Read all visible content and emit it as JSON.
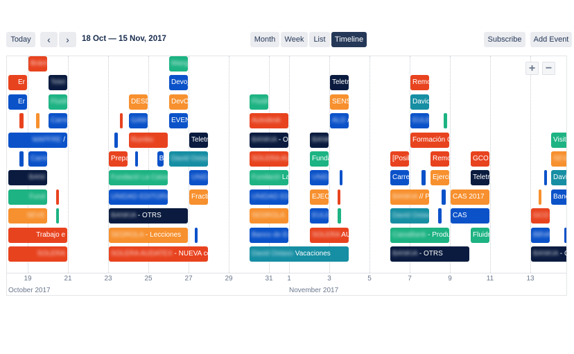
{
  "toolbar": {
    "today_label": "Today",
    "prev_icon": "chevron-left",
    "next_icon": "chevron-right",
    "prev_glyph": "‹",
    "next_glyph": "›",
    "date_range": "18 Oct — 15 Nov, 2017",
    "views": [
      {
        "label": "Month",
        "active": false
      },
      {
        "label": "Week",
        "active": false
      },
      {
        "label": "List",
        "active": false
      },
      {
        "label": "Timeline",
        "active": true
      }
    ],
    "subscribe_label": "Subscribe",
    "add_event_label": "Add Event"
  },
  "zoom_controls": {
    "zoom_in_glyph": "+",
    "zoom_out_glyph": "−"
  },
  "colors": {
    "red": "#e8431f",
    "blue": "#0b52c9",
    "green": "#1db382",
    "orange": "#f7902e",
    "navy": "#0a1b3f",
    "teal": "#168ea3",
    "active_view": "#253858"
  },
  "axis": {
    "start_date": "2017-10-18",
    "ticks": [
      {
        "label": "19",
        "day": 1
      },
      {
        "label": "21",
        "day": 3
      },
      {
        "label": "23",
        "day": 5
      },
      {
        "label": "25",
        "day": 7
      },
      {
        "label": "27",
        "day": 9
      },
      {
        "label": "29",
        "day": 11
      },
      {
        "label": "31",
        "day": 13
      },
      {
        "label": "1",
        "day": 14
      },
      {
        "label": "3",
        "day": 16
      },
      {
        "label": "5",
        "day": 18
      },
      {
        "label": "7",
        "day": 20
      },
      {
        "label": "9",
        "day": 22
      },
      {
        "label": "11",
        "day": 24
      },
      {
        "label": "13",
        "day": 26
      },
      {
        "label": "15",
        "day": 28
      }
    ],
    "months": [
      {
        "label": "October 2017",
        "day": 0
      },
      {
        "label": "November 2017",
        "day": 14
      }
    ]
  },
  "events": [
    {
      "row": 0,
      "start": 1.0,
      "end": 2.0,
      "color": "red",
      "hidden": "Bránt",
      "text": ""
    },
    {
      "row": 0,
      "start": 8.0,
      "end": 9.0,
      "color": "green",
      "hidden": "Mang",
      "text": ""
    },
    {
      "row": 1,
      "start": 0.0,
      "end": 1.0,
      "color": "red",
      "hidden": "",
      "text": "Er",
      "align": "r"
    },
    {
      "row": 1,
      "start": 2.0,
      "end": 3.0,
      "color": "navy",
      "hidden": "Telet",
      "text": ""
    },
    {
      "row": 1,
      "start": 8.0,
      "end": 9.0,
      "color": "blue",
      "hidden": "",
      "text": "Devoj"
    },
    {
      "row": 1,
      "start": 16.0,
      "end": 17.0,
      "color": "navy",
      "hidden": "",
      "text": "Teletr"
    },
    {
      "row": 1,
      "start": 20.0,
      "end": 21.0,
      "color": "red",
      "hidden": "",
      "text": "Remo"
    },
    {
      "row": 2,
      "start": 0.0,
      "end": 1.0,
      "color": "blue",
      "hidden": "",
      "text": "Er",
      "align": "r"
    },
    {
      "row": 2,
      "start": 2.0,
      "end": 3.0,
      "color": "green",
      "hidden": "Fluidi",
      "text": ""
    },
    {
      "row": 2,
      "start": 6.0,
      "end": 7.0,
      "color": "orange",
      "hidden": "",
      "text": "DESD"
    },
    {
      "row": 2,
      "start": 8.0,
      "end": 9.0,
      "color": "orange",
      "hidden": "",
      "text": "DevO"
    },
    {
      "row": 2,
      "start": 12.0,
      "end": 13.0,
      "color": "green",
      "hidden": "Fluidi",
      "text": ""
    },
    {
      "row": 2,
      "start": 16.0,
      "end": 17.0,
      "color": "orange",
      "hidden": "",
      "text": "SENS"
    },
    {
      "row": 2,
      "start": 20.0,
      "end": 21.0,
      "color": "teal",
      "hidden": "",
      "text": "David"
    },
    {
      "row": 3,
      "start": 0.6,
      "end": 0.8,
      "color": "red",
      "hidden": "",
      "text": "",
      "thin": true
    },
    {
      "row": 3,
      "start": 1.4,
      "end": 1.6,
      "color": "orange",
      "hidden": "",
      "text": "",
      "thin": true
    },
    {
      "row": 3,
      "start": 2.0,
      "end": 3.0,
      "color": "blue",
      "hidden": "Carre",
      "text": ""
    },
    {
      "row": 3,
      "start": 5.6,
      "end": 5.72,
      "color": "red",
      "hidden": "",
      "text": "",
      "thin": true
    },
    {
      "row": 3,
      "start": 6.0,
      "end": 7.0,
      "color": "blue",
      "hidden": "GAM",
      "text": ""
    },
    {
      "row": 3,
      "start": 8.0,
      "end": 9.0,
      "color": "blue",
      "hidden": "",
      "text": "EVEN"
    },
    {
      "row": 3,
      "start": 12.0,
      "end": 14.0,
      "color": "red",
      "hidden": "Autodesk",
      "text": ""
    },
    {
      "row": 3,
      "start": 16.0,
      "end": 17.0,
      "color": "blue",
      "hidden": "ALD",
      "text": " /"
    },
    {
      "row": 3,
      "start": 20.0,
      "end": 21.0,
      "color": "blue",
      "hidden": "EULE",
      "text": ""
    },
    {
      "row": 3,
      "start": 21.7,
      "end": 21.85,
      "color": "green",
      "hidden": "",
      "text": "",
      "thin": true
    },
    {
      "row": 4,
      "start": 0.0,
      "end": 3.0,
      "color": "blue",
      "hidden": "MAPFRE",
      "text": " /",
      "align": "r"
    },
    {
      "row": 4,
      "start": 5.3,
      "end": 5.5,
      "color": "blue",
      "hidden": "",
      "text": "",
      "thin": true
    },
    {
      "row": 4,
      "start": 6.0,
      "end": 8.0,
      "color": "red",
      "hidden": "Rumbo",
      "text": ""
    },
    {
      "row": 4,
      "start": 9.0,
      "end": 10.0,
      "color": "navy",
      "hidden": "",
      "text": "Teletr"
    },
    {
      "row": 4,
      "start": 12.0,
      "end": 14.0,
      "color": "navy",
      "hidden": "BANKIA",
      "text": " - O'"
    },
    {
      "row": 4,
      "start": 15.0,
      "end": 16.0,
      "color": "navy",
      "hidden": "BANK",
      "text": ""
    },
    {
      "row": 4,
      "start": 20.0,
      "end": 22.0,
      "color": "red",
      "hidden": "",
      "text": "Formación C"
    },
    {
      "row": 4,
      "start": 27.0,
      "end": 28.0,
      "color": "green",
      "hidden": "",
      "text": "Visita"
    },
    {
      "row": 5,
      "start": 0.6,
      "end": 0.8,
      "color": "blue",
      "hidden": "",
      "text": "",
      "thin": true
    },
    {
      "row": 5,
      "start": 1.0,
      "end": 2.0,
      "color": "blue",
      "hidden": "Carre",
      "text": ""
    },
    {
      "row": 5,
      "start": 5.0,
      "end": 6.0,
      "color": "red",
      "hidden": "",
      "text": "Prepa"
    },
    {
      "row": 5,
      "start": 6.35,
      "end": 6.45,
      "color": "blue",
      "hidden": "",
      "text": "",
      "thin": true
    },
    {
      "row": 5,
      "start": 7.4,
      "end": 7.8,
      "color": "blue",
      "hidden": "",
      "text": "B"
    },
    {
      "row": 5,
      "start": 8.0,
      "end": 10.0,
      "color": "teal",
      "hidden": "David Ostas",
      "text": ""
    },
    {
      "row": 5,
      "start": 12.0,
      "end": 14.0,
      "color": "red",
      "hidden": "SOLERA AU",
      "text": ""
    },
    {
      "row": 5,
      "start": 15.0,
      "end": 16.0,
      "color": "green",
      "hidden": "",
      "text": "Funda"
    },
    {
      "row": 5,
      "start": 19.0,
      "end": 20.0,
      "color": "red",
      "hidden": "",
      "text": "[Posil"
    },
    {
      "row": 5,
      "start": 21.0,
      "end": 22.0,
      "color": "red",
      "hidden": "",
      "text": "Remc"
    },
    {
      "row": 5,
      "start": 23.0,
      "end": 24.0,
      "color": "red",
      "hidden": "",
      "text": "GCO"
    },
    {
      "row": 5,
      "start": 27.0,
      "end": 28.0,
      "color": "orange",
      "hidden": "SEVE",
      "text": ""
    },
    {
      "row": 6,
      "start": 0.0,
      "end": 2.0,
      "color": "navy",
      "hidden": "BANI",
      "text": "",
      "align": "r"
    },
    {
      "row": 6,
      "start": 5.0,
      "end": 8.0,
      "color": "green",
      "hidden": "Fundació La Caixa",
      "text": ""
    },
    {
      "row": 6,
      "start": 9.0,
      "end": 10.0,
      "color": "blue",
      "hidden": "UNID",
      "text": ""
    },
    {
      "row": 6,
      "start": 12.0,
      "end": 14.0,
      "color": "green",
      "hidden": "Fundació",
      "text": " La"
    },
    {
      "row": 6,
      "start": 15.0,
      "end": 16.0,
      "color": "blue",
      "hidden": "UNID",
      "text": ""
    },
    {
      "row": 6,
      "start": 16.5,
      "end": 16.6,
      "color": "blue",
      "hidden": "",
      "text": "",
      "thin": true
    },
    {
      "row": 6,
      "start": 19.0,
      "end": 20.0,
      "color": "blue",
      "hidden": "",
      "text": "Carre"
    },
    {
      "row": 6,
      "start": 20.6,
      "end": 20.8,
      "color": "blue",
      "hidden": "",
      "text": "",
      "thin": true
    },
    {
      "row": 6,
      "start": 21.0,
      "end": 22.0,
      "color": "orange",
      "hidden": "",
      "text": "Ejerci"
    },
    {
      "row": 6,
      "start": 23.0,
      "end": 24.0,
      "color": "navy",
      "hidden": "",
      "text": "Teletr"
    },
    {
      "row": 6,
      "start": 26.7,
      "end": 26.8,
      "color": "blue",
      "hidden": "",
      "text": "",
      "thin": true
    },
    {
      "row": 6,
      "start": 27.0,
      "end": 28.0,
      "color": "teal",
      "hidden": "",
      "text": "David"
    },
    {
      "row": 7,
      "start": 0.0,
      "end": 2.0,
      "color": "green",
      "hidden": "Fund",
      "text": "",
      "align": "r"
    },
    {
      "row": 7,
      "start": 2.4,
      "end": 2.5,
      "color": "red",
      "hidden": "",
      "text": "",
      "thin": true
    },
    {
      "row": 7,
      "start": 5.0,
      "end": 8.0,
      "color": "blue",
      "hidden": "UNIDAD EDITORIA",
      "text": ""
    },
    {
      "row": 7,
      "start": 9.0,
      "end": 10.0,
      "color": "orange",
      "hidden": "",
      "text": "Fracti"
    },
    {
      "row": 7,
      "start": 12.0,
      "end": 14.0,
      "color": "blue",
      "hidden": "UNIDAD EDI",
      "text": ""
    },
    {
      "row": 7,
      "start": 15.0,
      "end": 16.0,
      "color": "orange",
      "hidden": "",
      "text": "EJECI"
    },
    {
      "row": 7,
      "start": 16.4,
      "end": 16.55,
      "color": "red",
      "hidden": "",
      "text": "",
      "thin": true
    },
    {
      "row": 7,
      "start": 19.0,
      "end": 21.0,
      "color": "orange",
      "hidden": "BANKIA",
      "text": " // P"
    },
    {
      "row": 7,
      "start": 21.6,
      "end": 21.8,
      "color": "blue",
      "hidden": "",
      "text": "",
      "thin": true
    },
    {
      "row": 7,
      "start": 22.0,
      "end": 24.0,
      "color": "orange",
      "hidden": "",
      "text": "CAS 2017"
    },
    {
      "row": 7,
      "start": 26.4,
      "end": 26.5,
      "color": "orange",
      "hidden": "",
      "text": "",
      "thin": true
    },
    {
      "row": 7,
      "start": 27.0,
      "end": 28.0,
      "color": "blue",
      "hidden": "",
      "text": "Banco"
    },
    {
      "row": 8,
      "start": 0.0,
      "end": 2.0,
      "color": "orange",
      "hidden": "SEVE",
      "text": "",
      "align": "r"
    },
    {
      "row": 8,
      "start": 2.4,
      "end": 2.55,
      "color": "green",
      "hidden": "",
      "text": "",
      "thin": true
    },
    {
      "row": 8,
      "start": 5.0,
      "end": 9.0,
      "color": "navy",
      "hidden": "BANKIA",
      "text": " - OTRS"
    },
    {
      "row": 8,
      "start": 12.0,
      "end": 14.0,
      "color": "orange",
      "hidden": "SEDROLA",
      "text": ""
    },
    {
      "row": 8,
      "start": 15.0,
      "end": 16.0,
      "color": "blue",
      "hidden": "EULE",
      "text": ""
    },
    {
      "row": 8,
      "start": 16.4,
      "end": 16.6,
      "color": "green",
      "hidden": "",
      "text": "",
      "thin": true
    },
    {
      "row": 8,
      "start": 19.0,
      "end": 21.0,
      "color": "teal",
      "hidden": "David Ostas",
      "text": ""
    },
    {
      "row": 8,
      "start": 21.4,
      "end": 21.6,
      "color": "blue",
      "hidden": "",
      "text": "",
      "thin": true
    },
    {
      "row": 8,
      "start": 22.0,
      "end": 24.0,
      "color": "blue",
      "hidden": "",
      "text": "CAS"
    },
    {
      "row": 8,
      "start": 26.0,
      "end": 27.0,
      "color": "red",
      "hidden": "GCO",
      "text": ""
    },
    {
      "row": 9,
      "start": 0.0,
      "end": 3.0,
      "color": "red",
      "hidden": "",
      "text": "Trabajo e",
      "align": "r"
    },
    {
      "row": 9,
      "start": 5.0,
      "end": 9.0,
      "color": "orange",
      "hidden": "SEDROLA",
      "text": " - Lecciones"
    },
    {
      "row": 9,
      "start": 9.3,
      "end": 9.4,
      "color": "blue",
      "hidden": "",
      "text": "",
      "thin": true
    },
    {
      "row": 9,
      "start": 12.0,
      "end": 14.0,
      "color": "blue",
      "hidden": "Banco de Es",
      "text": ""
    },
    {
      "row": 9,
      "start": 15.0,
      "end": 17.0,
      "color": "red",
      "hidden": "SOLERA",
      "text": " AU"
    },
    {
      "row": 9,
      "start": 19.0,
      "end": 22.0,
      "color": "green",
      "hidden": "CaixaBank",
      "text": " - Produ"
    },
    {
      "row": 9,
      "start": 23.0,
      "end": 24.0,
      "color": "green",
      "hidden": "",
      "text": "Fluidr"
    },
    {
      "row": 9,
      "start": 26.0,
      "end": 27.0,
      "color": "blue",
      "hidden": "BBVA",
      "text": ""
    },
    {
      "row": 9,
      "start": 27.7,
      "end": 27.8,
      "color": "blue",
      "hidden": "",
      "text": "",
      "thin": true
    },
    {
      "row": 10,
      "start": 0.0,
      "end": 3.0,
      "color": "red",
      "hidden": "SOLERA",
      "text": "",
      "align": "r"
    },
    {
      "row": 10,
      "start": 5.0,
      "end": 10.0,
      "color": "red",
      "hidden": "SOLERA AUDATEX",
      "text": " - NUEVA col"
    },
    {
      "row": 10,
      "start": 12.0,
      "end": 17.0,
      "color": "teal",
      "hidden": "David Ostaso",
      "text": " Vacaciones"
    },
    {
      "row": 10,
      "start": 19.0,
      "end": 23.0,
      "color": "navy",
      "hidden": "BANKIA",
      "text": " - OTRS"
    },
    {
      "row": 10,
      "start": 26.0,
      "end": 28.0,
      "color": "navy",
      "hidden": "BANKIA",
      "text": " - OT"
    }
  ]
}
